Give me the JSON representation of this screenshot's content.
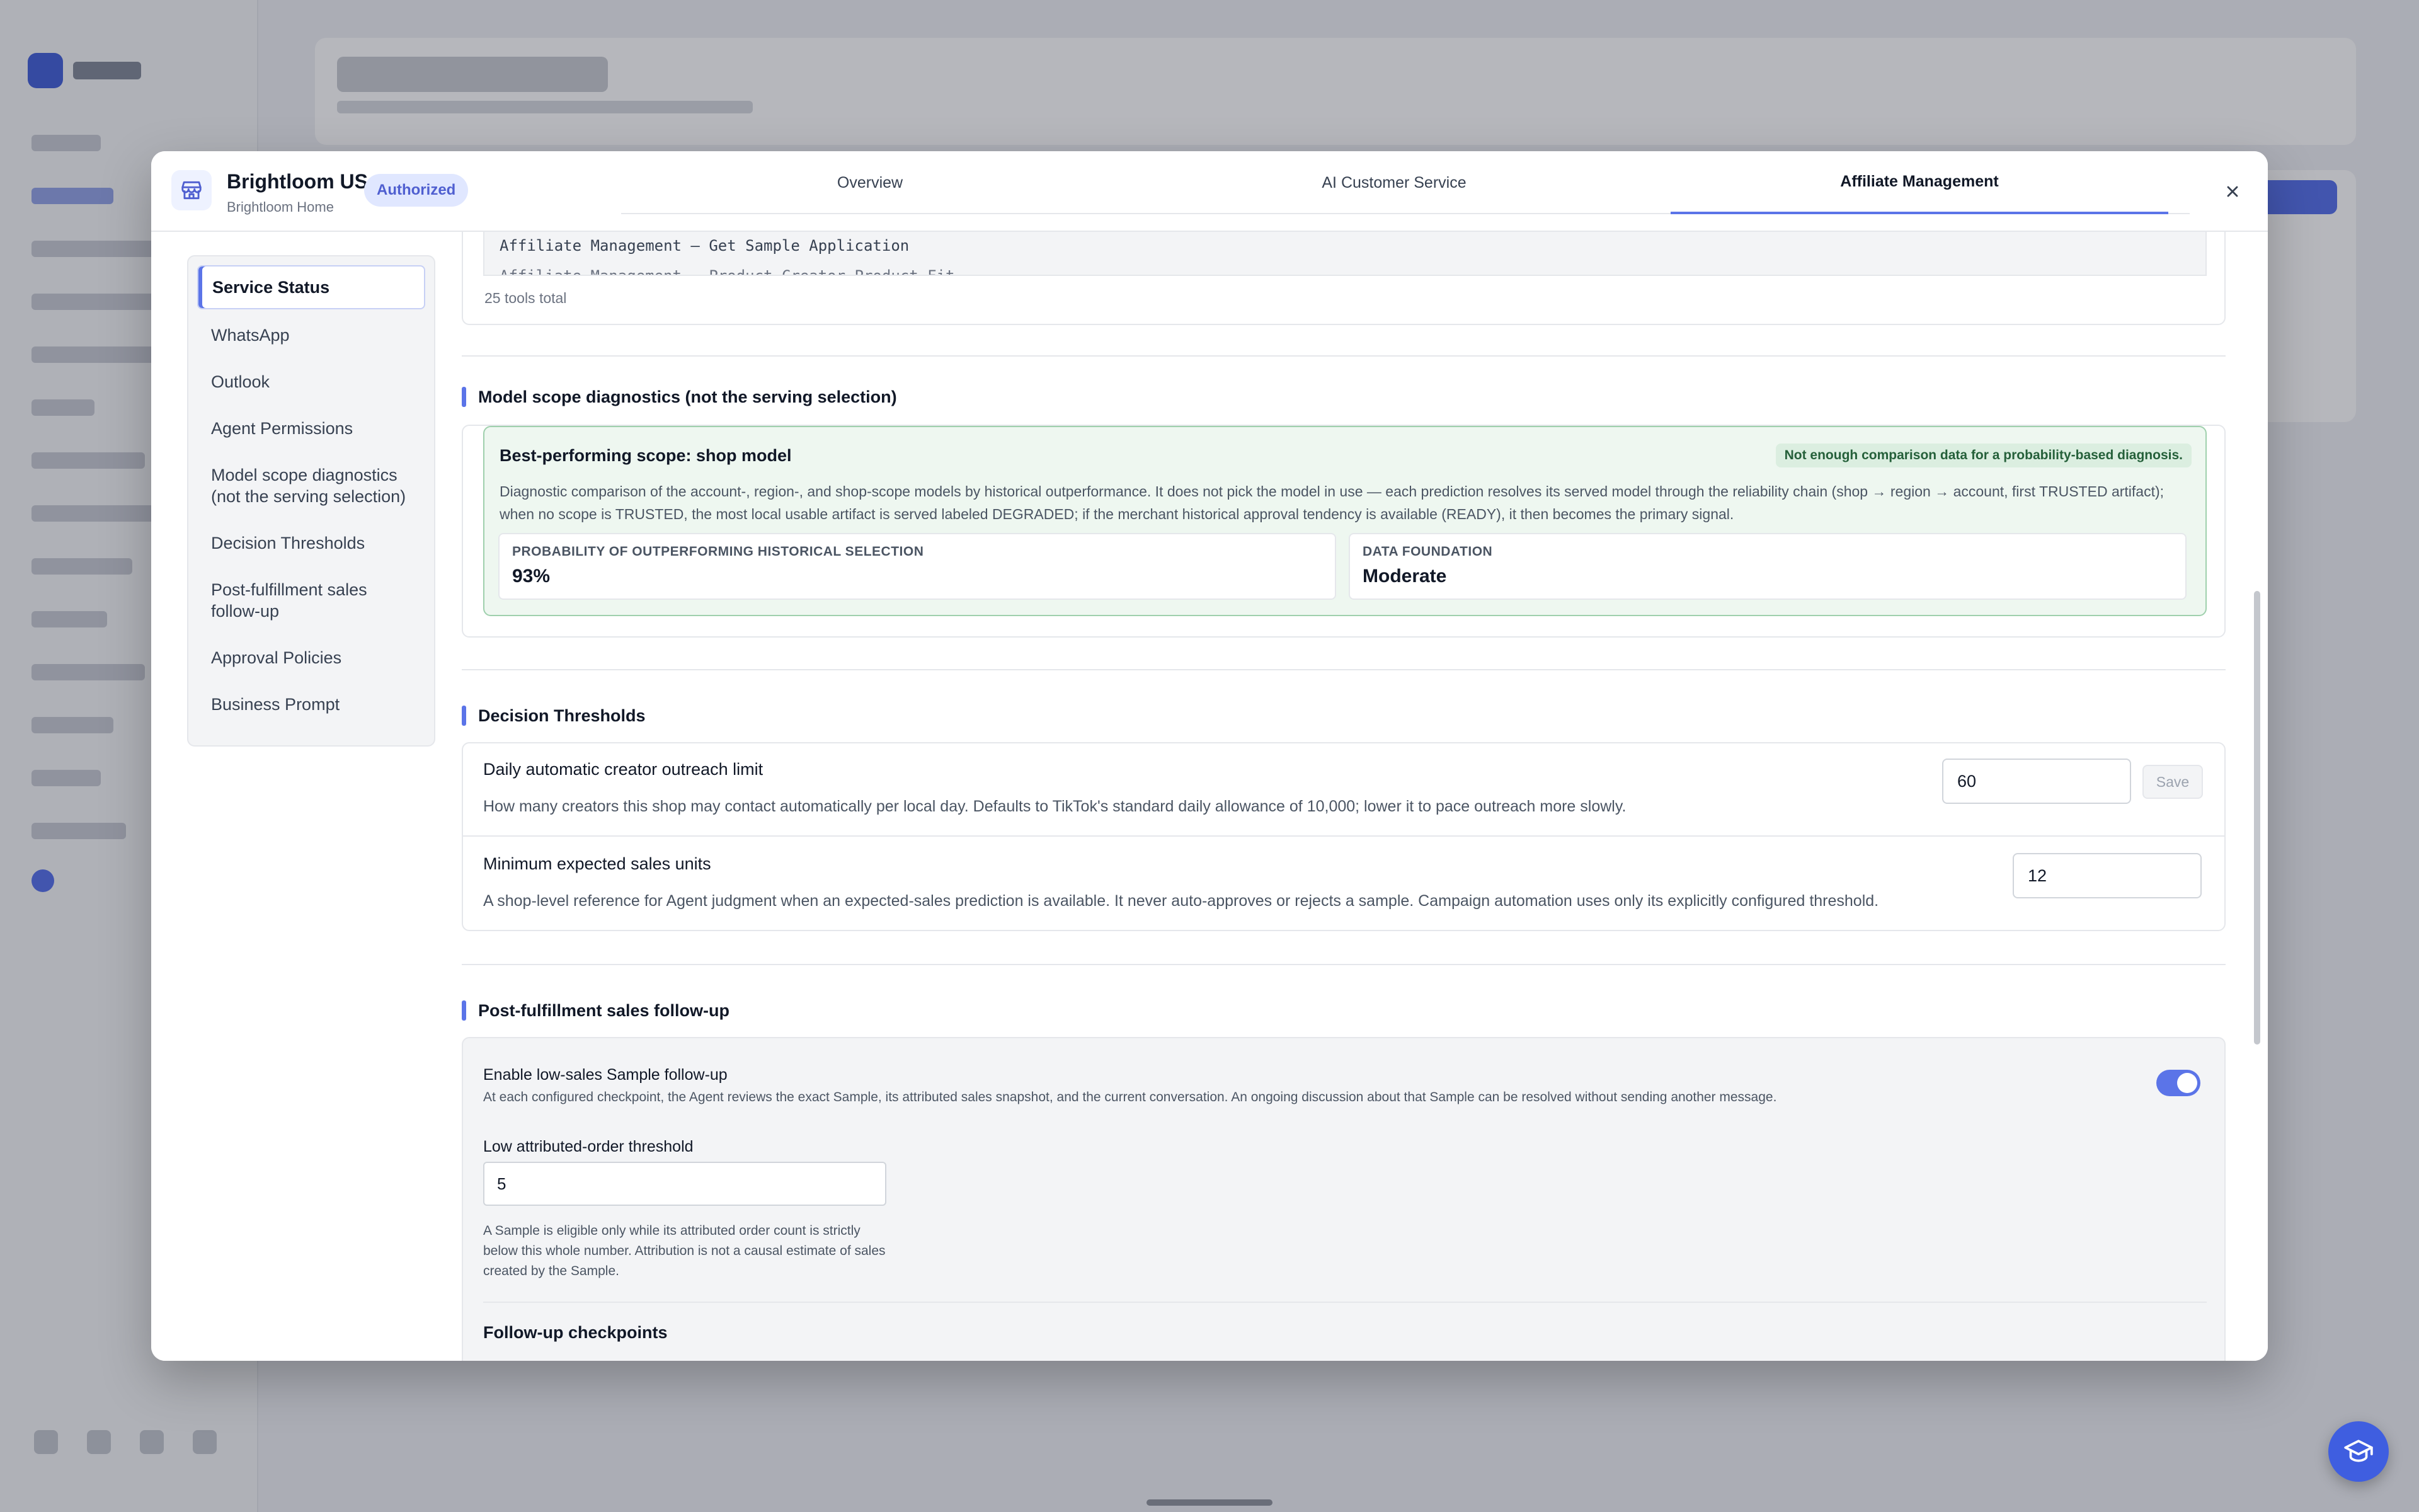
{
  "header": {
    "shop_name": "Brightloom US",
    "shop_subtitle": "Brightloom Home",
    "status_badge": "Authorized",
    "tabs": [
      {
        "label": "Overview",
        "active": false
      },
      {
        "label": "AI Customer Service",
        "active": false
      },
      {
        "label": "Affiliate Management",
        "active": true
      }
    ]
  },
  "sidebar": {
    "items": [
      {
        "label": "Service Status",
        "active": true
      },
      {
        "label": "WhatsApp"
      },
      {
        "label": "Outlook"
      },
      {
        "label": "Agent Permissions"
      },
      {
        "label": "Model scope diagnostics (not the serving selection)"
      },
      {
        "label": "Decision Thresholds"
      },
      {
        "label": "Post-fulfillment sales follow-up"
      },
      {
        "label": "Approval Policies"
      },
      {
        "label": "Business Prompt"
      }
    ]
  },
  "tools": {
    "rows": [
      "Affiliate Management — Get Sample Application",
      "Affiliate Management — Product Creator Product Fit"
    ],
    "total_label": "25 tools total"
  },
  "diagnostics": {
    "section_title": "Model scope diagnostics (not the serving selection)",
    "card_title": "Best-performing scope: shop model",
    "badge": "Not enough comparison data for a probability-based diagnosis.",
    "description": "Diagnostic comparison of the account-, region-, and shop-scope models by historical outperformance. It does not pick the model in use — each prediction resolves its served model through the reliability chain (shop → region → account, first TRUSTED artifact); when no scope is TRUSTED, the most local usable artifact is served labeled DEGRADED; if the merchant historical approval tendency is available (READY), it then becomes the primary signal.",
    "metrics": [
      {
        "label": "PROBABILITY OF OUTPERFORMING HISTORICAL SELECTION",
        "value": "93%"
      },
      {
        "label": "DATA FOUNDATION",
        "value": "Moderate"
      }
    ]
  },
  "thresholds": {
    "section_title": "Decision Thresholds",
    "rows": [
      {
        "title": "Daily automatic creator outreach limit",
        "description": "How many creators this shop may contact automatically per local day. Defaults to TikTok's standard daily allowance of 10,000; lower it to pace outreach more slowly.",
        "value": "60",
        "save_label": "Save"
      },
      {
        "title": "Minimum expected sales units",
        "description": "A shop-level reference for Agent judgment when an expected-sales prediction is available. It never auto-approves or rejects a sample. Campaign automation uses only its explicitly configured threshold.",
        "value": "12"
      }
    ]
  },
  "followup": {
    "section_title": "Post-fulfillment sales follow-up",
    "toggle_title": "Enable low-sales Sample follow-up",
    "toggle_description": "At each configured checkpoint, the Agent reviews the exact Sample, its attributed sales snapshot, and the current conversation. An ongoing discussion about that Sample can be resolved without sending another message.",
    "toggle_on": true,
    "threshold_label": "Low attributed-order threshold",
    "threshold_value": "5",
    "threshold_help": "A Sample is eligible only while its attributed order count is strictly below this whole number. Attribution is not a causal estimate of sales created by the Sample.",
    "checkpoints_title": "Follow-up checkpoints"
  },
  "colors": {
    "accent": "#5b74e8",
    "diag_bg": "#eef7f0",
    "diag_border": "#9fd0ad"
  }
}
